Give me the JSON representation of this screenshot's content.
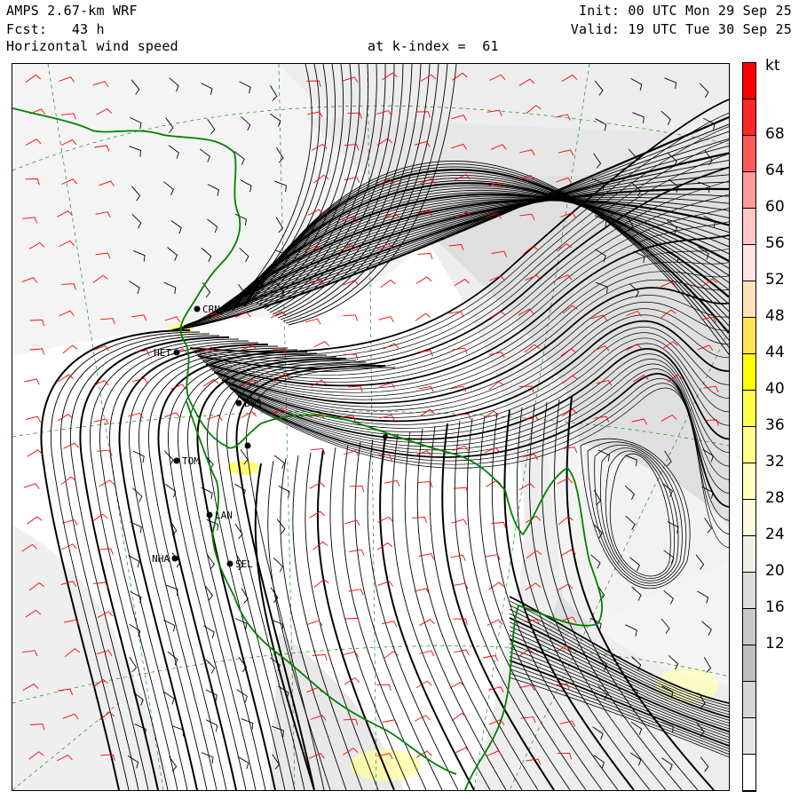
{
  "header": {
    "model": "AMPS 2.67-km WRF",
    "fcst": "Fcst:   43 h",
    "field": "Horizontal wind speed",
    "level": "at k-index =  61",
    "init": "Init: 00 UTC Mon 29 Sep 25",
    "valid": "Valid: 19 UTC Tue 30 Sep 25"
  },
  "colorbar": {
    "unit": "kt",
    "labels": [
      "68",
      "64",
      "60",
      "56",
      "52",
      "48",
      "44",
      "40",
      "36",
      "32",
      "28",
      "24",
      "20",
      "16",
      "12"
    ],
    "colors": [
      "#ff0000",
      "#ff2828",
      "#ff5a5a",
      "#ff9a9a",
      "#ffc8c8",
      "#ffe4e4",
      "#ffe3b8",
      "#ffe455",
      "#ffff00",
      "#ffff4a",
      "#ffff8c",
      "#ffffc0",
      "#fbfbdc",
      "#f0f0e6",
      "#dcdcdc",
      "#c8c8c8",
      "#bebebe",
      "#d7d7d7",
      "#e6e6e6",
      "#ffffff"
    ]
  },
  "stations": [
    {
      "id": "CRN",
      "label": "CRN"
    },
    {
      "id": "HET",
      "label": "HET"
    },
    {
      "id": "BYS",
      "label": "BYS"
    },
    {
      "id": "TOM",
      "label": "TOM"
    },
    {
      "id": "LAN",
      "label": "LAN"
    },
    {
      "id": "NHA",
      "label": "NHA"
    },
    {
      "id": "SEL",
      "label": "SEL"
    }
  ],
  "colors": {
    "contour": "#000000",
    "coastline": "#008000",
    "barbs_fast": "#ff0000",
    "barbs_slow": "#000000",
    "shade_light": "#e8e8e8",
    "shade_mid": "#d2d2d2"
  }
}
